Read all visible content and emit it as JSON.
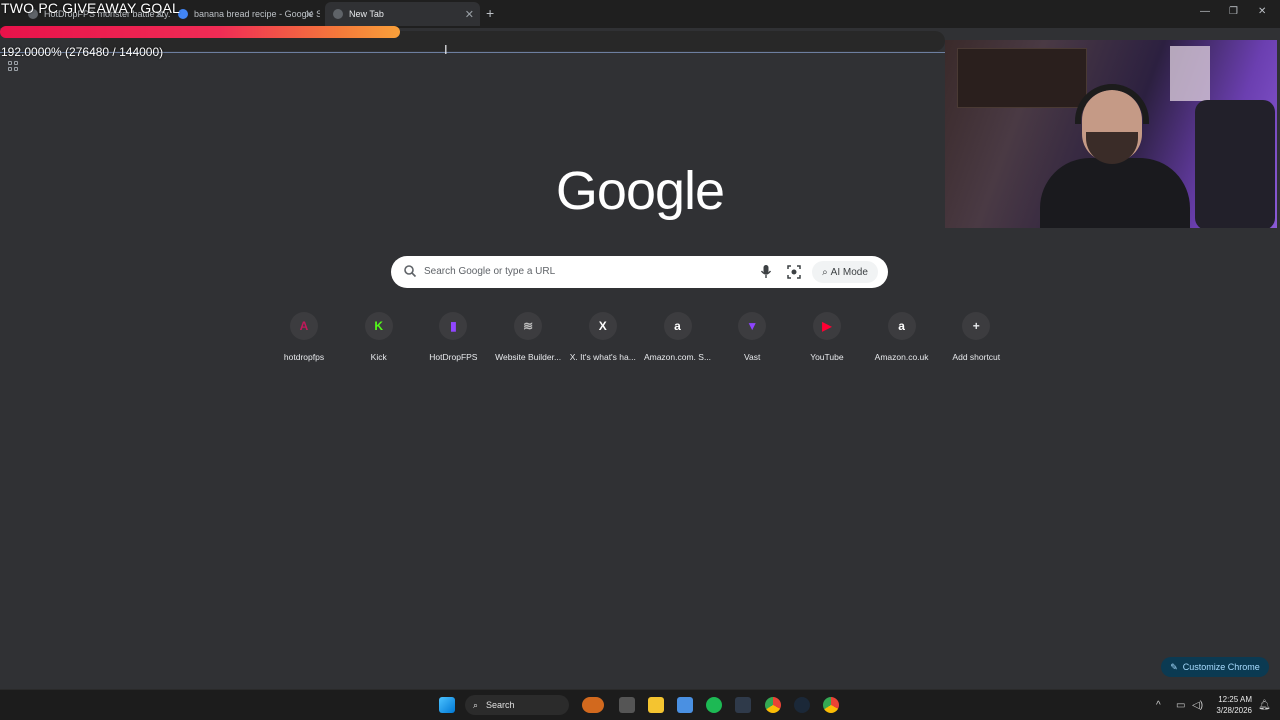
{
  "browser": {
    "tabs": [
      {
        "label": "HotDropFPS monster battle sty...",
        "active": false
      },
      {
        "label": "banana bread recipe - Google S",
        "active": false
      },
      {
        "label": "New Tab",
        "active": true
      }
    ],
    "new_tab_glyph": "+",
    "window_controls": [
      "—",
      "❐",
      "✕"
    ]
  },
  "overlay": {
    "title": "TWO PC GIVEAWAY GOAL",
    "goal_text": "192.0000% (276480 / 144000)",
    "goal_fraction": 1.92,
    "bar_colors": [
      "#e8124a",
      "#f9a03a"
    ]
  },
  "newtab": {
    "logo": "Google",
    "search_placeholder": "Search Google or type a URL",
    "ai_mode_label": "AI Mode",
    "shortcuts": [
      {
        "label": "hotdropfps",
        "icon": "hotdrop-icon",
        "glyph": "A",
        "color": "#c2185b"
      },
      {
        "label": "Kick",
        "icon": "kick-icon",
        "glyph": "K",
        "color": "#53fc18"
      },
      {
        "label": "HotDropFPS",
        "icon": "twitch-icon",
        "glyph": "▮",
        "color": "#9146ff"
      },
      {
        "label": "Website Builder...",
        "icon": "squarespace-icon",
        "glyph": "≋",
        "color": "#bdbdbd"
      },
      {
        "label": "X. It's what's ha...",
        "icon": "x-icon",
        "glyph": "X",
        "color": "#ffffff"
      },
      {
        "label": "Amazon.com. S...",
        "icon": "amazon-icon",
        "glyph": "a",
        "color": "#ffffff"
      },
      {
        "label": "Vast",
        "icon": "vast-icon",
        "glyph": "▼",
        "color": "#8e44ff"
      },
      {
        "label": "YouTube",
        "icon": "youtube-icon",
        "glyph": "▶",
        "color": "#ff0033"
      },
      {
        "label": "Amazon.co.uk",
        "icon": "amazon-icon",
        "glyph": "a",
        "color": "#ffffff"
      },
      {
        "label": "Add shortcut",
        "icon": "plus-icon",
        "glyph": "+",
        "color": "#e8eaed"
      }
    ],
    "customize_label": "Customize Chrome"
  },
  "taskbar": {
    "search_label": "Search",
    "time": "12:25 AM",
    "date": "3/28/2026"
  }
}
